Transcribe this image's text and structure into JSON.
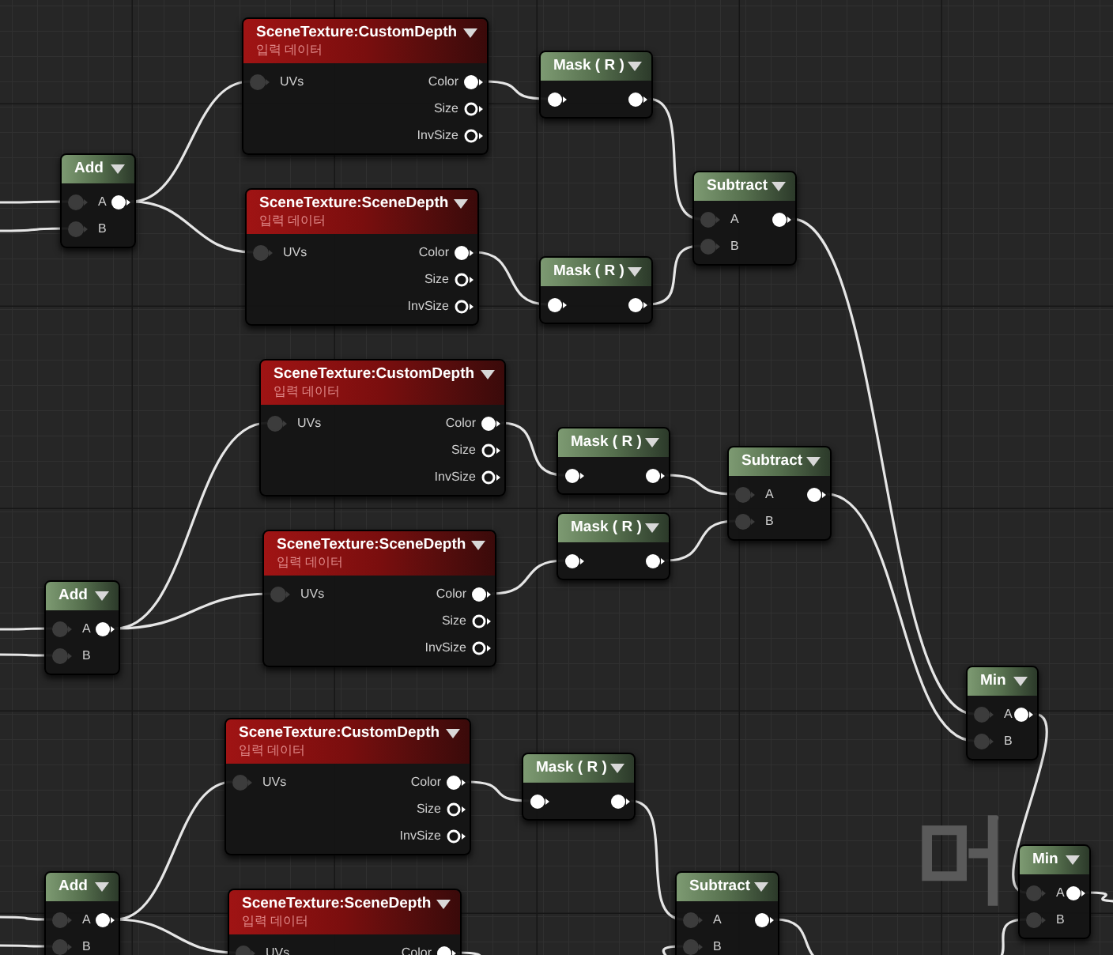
{
  "graph_label": "머",
  "nodes": [
    {
      "kind": "scene_texture",
      "title": "SceneTexture:CustomDepth",
      "subtitle": "입력 데이터",
      "inputs": [
        {
          "label": "UVs",
          "connected": true
        }
      ],
      "outputs": [
        {
          "label": "Color",
          "connected": true
        },
        {
          "label": "Size",
          "connected": false
        },
        {
          "label": "InvSize",
          "connected": false
        }
      ]
    },
    {
      "kind": "scene_texture",
      "title": "SceneTexture:SceneDepth",
      "subtitle": "입력 데이터",
      "inputs": [
        {
          "label": "UVs",
          "connected": true
        }
      ],
      "outputs": [
        {
          "label": "Color",
          "connected": true
        },
        {
          "label": "Size",
          "connected": false
        },
        {
          "label": "InvSize",
          "connected": false
        }
      ]
    },
    {
      "kind": "scene_texture",
      "title": "SceneTexture:CustomDepth",
      "subtitle": "입력 데이터",
      "inputs": [
        {
          "label": "UVs",
          "connected": true
        }
      ],
      "outputs": [
        {
          "label": "Color",
          "connected": true
        },
        {
          "label": "Size",
          "connected": false
        },
        {
          "label": "InvSize",
          "connected": false
        }
      ]
    },
    {
      "kind": "scene_texture",
      "title": "SceneTexture:SceneDepth",
      "subtitle": "입력 데이터",
      "inputs": [
        {
          "label": "UVs",
          "connected": true
        }
      ],
      "outputs": [
        {
          "label": "Color",
          "connected": true
        },
        {
          "label": "Size",
          "connected": false
        },
        {
          "label": "InvSize",
          "connected": false
        }
      ]
    },
    {
      "kind": "scene_texture",
      "title": "SceneTexture:CustomDepth",
      "subtitle": "입력 데이터",
      "inputs": [
        {
          "label": "UVs",
          "connected": true
        }
      ],
      "outputs": [
        {
          "label": "Color",
          "connected": true
        },
        {
          "label": "Size",
          "connected": false
        },
        {
          "label": "InvSize",
          "connected": false
        }
      ]
    },
    {
      "kind": "scene_texture",
      "title": "SceneTexture:SceneDepth",
      "subtitle": "입력 데이터",
      "inputs": [
        {
          "label": "UVs",
          "connected": true
        }
      ],
      "outputs": [
        {
          "label": "Color",
          "connected": true
        }
      ]
    },
    {
      "kind": "math",
      "title": "Add",
      "inputs": [
        {
          "label": "A",
          "connected": true
        },
        {
          "label": "B",
          "connected": true
        }
      ],
      "outputs": [
        {
          "connected": true
        }
      ]
    },
    {
      "kind": "math",
      "title": "Add",
      "inputs": [
        {
          "label": "A",
          "connected": true
        },
        {
          "label": "B",
          "connected": true
        }
      ],
      "outputs": [
        {
          "connected": true
        }
      ]
    },
    {
      "kind": "math",
      "title": "Add",
      "inputs": [
        {
          "label": "A",
          "connected": true
        },
        {
          "label": "B",
          "connected": true
        }
      ],
      "outputs": [
        {
          "connected": true
        }
      ]
    },
    {
      "kind": "mask",
      "title": "Mask ( R )",
      "inputs": [
        {
          "connected": true
        }
      ],
      "outputs": [
        {
          "connected": true
        }
      ]
    },
    {
      "kind": "mask",
      "title": "Mask ( R )",
      "inputs": [
        {
          "connected": true
        }
      ],
      "outputs": [
        {
          "connected": true
        }
      ]
    },
    {
      "kind": "mask",
      "title": "Mask ( R )",
      "inputs": [
        {
          "connected": true
        }
      ],
      "outputs": [
        {
          "connected": true
        }
      ]
    },
    {
      "kind": "mask",
      "title": "Mask ( R )",
      "inputs": [
        {
          "connected": true
        }
      ],
      "outputs": [
        {
          "connected": true
        }
      ]
    },
    {
      "kind": "mask",
      "title": "Mask ( R )",
      "inputs": [
        {
          "connected": true
        }
      ],
      "outputs": [
        {
          "connected": true
        }
      ]
    },
    {
      "kind": "math",
      "title": "Subtract",
      "inputs": [
        {
          "label": "A",
          "connected": true
        },
        {
          "label": "B",
          "connected": true
        }
      ],
      "outputs": [
        {
          "connected": true
        }
      ]
    },
    {
      "kind": "math",
      "title": "Subtract",
      "inputs": [
        {
          "label": "A",
          "connected": true
        },
        {
          "label": "B",
          "connected": true
        }
      ],
      "outputs": [
        {
          "connected": true
        }
      ]
    },
    {
      "kind": "math",
      "title": "Subtract",
      "inputs": [
        {
          "label": "A",
          "connected": true
        },
        {
          "label": "B",
          "connected": true
        }
      ],
      "outputs": [
        {
          "connected": true
        }
      ]
    },
    {
      "kind": "math",
      "title": "Min",
      "inputs": [
        {
          "label": "A",
          "connected": true
        },
        {
          "label": "B",
          "connected": true
        }
      ],
      "outputs": [
        {
          "connected": true
        }
      ]
    },
    {
      "kind": "math",
      "title": "Min",
      "inputs": [
        {
          "label": "A",
          "connected": true
        },
        {
          "label": "B",
          "connected": true
        }
      ],
      "outputs": [
        {
          "connected": true
        }
      ]
    }
  ]
}
